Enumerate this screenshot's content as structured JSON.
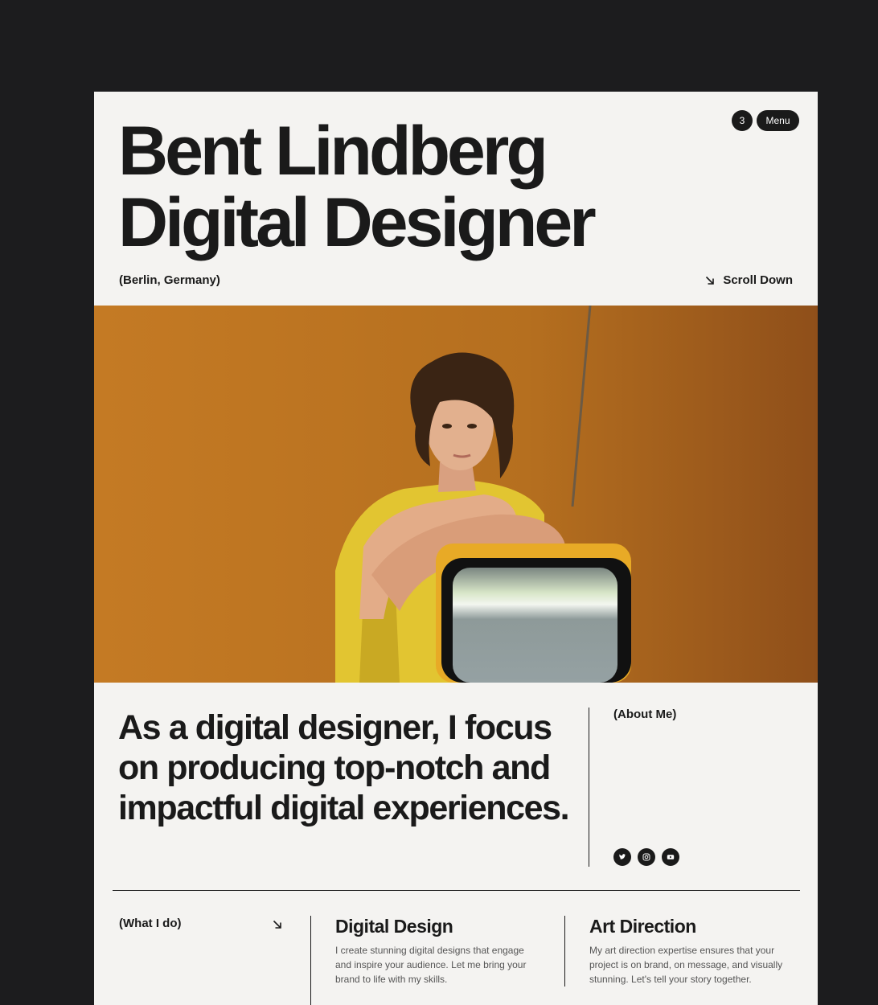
{
  "header": {
    "title_line1": "Bent Lindberg",
    "title_line2": "Digital Designer",
    "location": "(Berlin, Germany)",
    "scroll_label": "Scroll Down",
    "nav_count": "3",
    "menu_label": "Menu"
  },
  "about": {
    "statement": "As a digital designer, I focus on producing top-notch and impactful digital experiences.",
    "label": "(About Me)",
    "socials": [
      "twitter-icon",
      "instagram-icon",
      "youtube-icon"
    ]
  },
  "services": {
    "label": "(What I do)",
    "items": [
      {
        "title": "Digital Design",
        "description": "I create stunning digital designs that engage and inspire your audience. Let me bring your brand to life with my skills."
      },
      {
        "title": "Art Direction",
        "description": "My art direction expertise ensures that your project is on brand, on message, and visually stunning. Let's tell your story together."
      }
    ]
  },
  "colors": {
    "background": "#1c1c1e",
    "page": "#f4f3f1",
    "ink": "#1a1a1a",
    "photo_bg": "#b8701e"
  }
}
